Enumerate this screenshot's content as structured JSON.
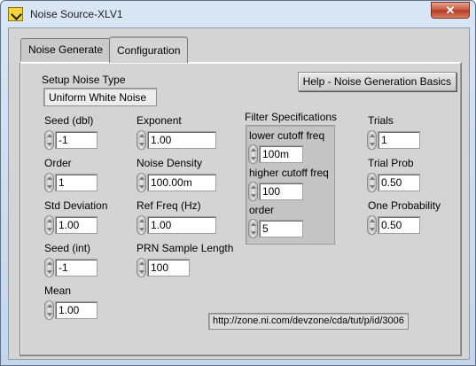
{
  "window": {
    "title": "Noise Source-XLV1",
    "close_glyph": "✕"
  },
  "tabs": [
    {
      "label": "Noise Generate",
      "active": false
    },
    {
      "label": "Configuration",
      "active": true
    }
  ],
  "help_button": {
    "label": "Help - Noise Generation Basics"
  },
  "setup": {
    "label": "Setup Noise Type",
    "value": "Uniform White Noise"
  },
  "column1": [
    {
      "label": "Seed (dbl)",
      "value": "-1"
    },
    {
      "label": "Order",
      "value": "1"
    },
    {
      "label": "Std Deviation",
      "value": "1.00"
    },
    {
      "label": "Seed (int)",
      "value": "-1"
    },
    {
      "label": "Mean",
      "value": "1.00"
    }
  ],
  "column2": [
    {
      "label": "Exponent",
      "value": "1.00"
    },
    {
      "label": "Noise Density",
      "value": "100.00m"
    },
    {
      "label": "Ref Freq (Hz)",
      "value": "1.00"
    },
    {
      "label": "PRN Sample Length",
      "value": "100"
    }
  ],
  "filter": {
    "title": "Filter Specifications",
    "fields": [
      {
        "label": "lower cutoff freq",
        "value": "100m"
      },
      {
        "label": "higher cutoff freq",
        "value": "100"
      },
      {
        "label": "order",
        "value": "5"
      }
    ]
  },
  "column4": [
    {
      "label": "Trials",
      "value": "1"
    },
    {
      "label": "Trial Prob",
      "value": "0.50"
    },
    {
      "label": "One Probability",
      "value": "0.50"
    }
  ],
  "url": "http://zone.ni.com/devzone/cda/tut/p/id/3006",
  "colors": {
    "titlebar": "#c3d6ec",
    "panel": "#d4d4d4",
    "close": "#c75a42"
  }
}
